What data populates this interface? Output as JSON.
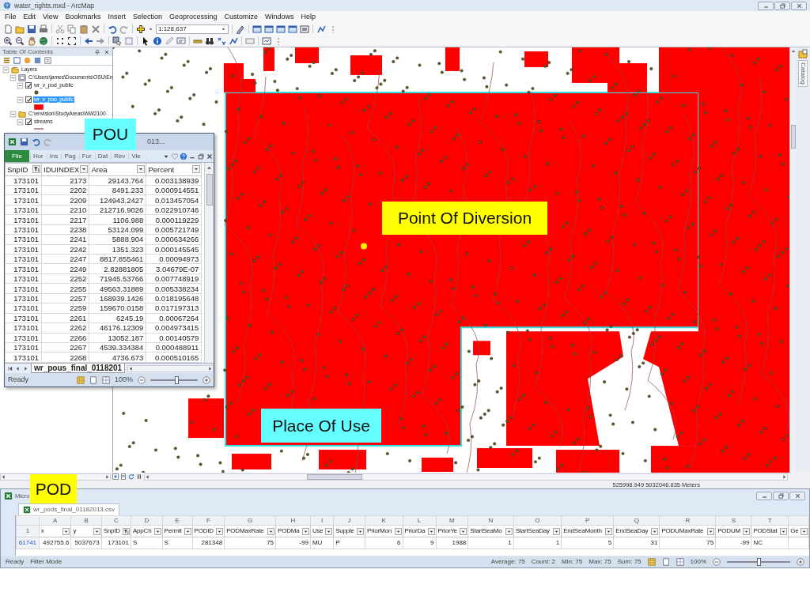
{
  "window": {
    "title": "water_rights.mxd - ArcMap"
  },
  "menu": [
    "File",
    "Edit",
    "View",
    "Bookmarks",
    "Insert",
    "Selection",
    "Geoprocessing",
    "Customize",
    "Windows",
    "Help"
  ],
  "toolbar": {
    "scale": "1:128,637"
  },
  "toc": {
    "title": "Table Of Contents",
    "tree": [
      {
        "label": "Layers",
        "kind": "frame",
        "expanded": true,
        "children": [
          {
            "label": "C:\\Users\\james\\Documents\\OSU\\En",
            "kind": "database",
            "expanded": true,
            "children": [
              {
                "label": "wr_v_pod_public",
                "kind": "point",
                "expanded": true,
                "checked": true,
                "selected": false
              },
              {
                "label": "wr_v_pou_public",
                "kind": "polygon",
                "expanded": true,
                "checked": true,
                "selected": true
              }
            ]
          },
          {
            "label": "C:\\envision\\StudyAreas\\WW2100",
            "kind": "folder",
            "expanded": true,
            "children": [
              {
                "label": "streams",
                "kind": "line",
                "expanded": true,
                "checked": true,
                "selected": false
              }
            ]
          }
        ]
      }
    ]
  },
  "catalog": "Catalog",
  "status_bar": {
    "coordinates": "525998.949  5032046.835 Meters"
  },
  "pou_sheet": {
    "title": "013...",
    "ribbon": [
      {
        "label": "File",
        "kind": "file"
      },
      {
        "label": "Hor",
        "kind": "tab"
      },
      {
        "label": "Ins",
        "kind": "tab"
      },
      {
        "label": "Pag",
        "kind": "tab"
      },
      {
        "label": "For",
        "kind": "tab"
      },
      {
        "label": "Dat",
        "kind": "tab"
      },
      {
        "label": "Rev",
        "kind": "tab"
      },
      {
        "label": "Vie",
        "kind": "tab"
      }
    ],
    "columns": [
      {
        "label": "SnpID",
        "filtered": true
      },
      {
        "label": "IDUINDEX",
        "filtered": false
      },
      {
        "label": "Area",
        "filtered": false
      },
      {
        "label": "Percent",
        "filtered": false
      }
    ],
    "rows": [
      [
        "173101",
        "2173",
        "29143.764",
        "0.003138939"
      ],
      [
        "173101",
        "2202",
        "8491.233",
        "0.000914551"
      ],
      [
        "173101",
        "2209",
        "124943.2427",
        "0.013457054"
      ],
      [
        "173101",
        "2210",
        "212716.9026",
        "0.022910746"
      ],
      [
        "173101",
        "2217",
        "1106.988",
        "0.000119229"
      ],
      [
        "173101",
        "2238",
        "53124.099",
        "0.005721749"
      ],
      [
        "173101",
        "2241",
        "5888.904",
        "0.000634266"
      ],
      [
        "173101",
        "2242",
        "1351.323",
        "0.000145545"
      ],
      [
        "173101",
        "2247",
        "8817.855461",
        "0.00094973"
      ],
      [
        "173101",
        "2249",
        "2.82881805",
        "3.04679E-07"
      ],
      [
        "173101",
        "2252",
        "71945.53766",
        "0.007748919"
      ],
      [
        "173101",
        "2255",
        "49563.31889",
        "0.005338234"
      ],
      [
        "173101",
        "2257",
        "168939.1426",
        "0.018195648"
      ],
      [
        "173101",
        "2259",
        "159670.0158",
        "0.017197313"
      ],
      [
        "173101",
        "2261",
        "6245.19",
        "0.00067264"
      ],
      [
        "173101",
        "2262",
        "46176.12309",
        "0.004973415"
      ],
      [
        "173101",
        "2266",
        "13052.187",
        "0.00140579"
      ],
      [
        "173101",
        "2267",
        "4539.334384",
        "0.000488911"
      ],
      [
        "173101",
        "2268",
        "4736.673",
        "0.000510165"
      ]
    ],
    "sheet_tab": "wr_pous_final_0118201",
    "status": "Ready",
    "zoom": "100%",
    "zoom_slider": {
      "level": 0.55
    }
  },
  "pod_sheet": {
    "title": "Micro",
    "file": "wr_pods_final_01182013.csv",
    "letters": [
      "A",
      "B",
      "C",
      "D",
      "E",
      "F",
      "G",
      "H",
      "I",
      "J",
      "K",
      "L",
      "M",
      "N",
      "O",
      "P",
      "Q",
      "R",
      "S",
      "T"
    ],
    "header_row": "1",
    "columns": [
      {
        "label": "x",
        "filtered": false
      },
      {
        "label": "y",
        "filtered": false
      },
      {
        "label": "SnpID",
        "filtered": true
      },
      {
        "label": "AppCh",
        "filtered": false
      },
      {
        "label": "Permit",
        "filtered": false
      },
      {
        "label": "PODID",
        "filtered": false
      },
      {
        "label": "PODMaxRate",
        "filtered": false
      },
      {
        "label": "PODMa",
        "filtered": false
      },
      {
        "label": "Use",
        "filtered": false
      },
      {
        "label": "Supple",
        "filtered": false
      },
      {
        "label": "PriorMon",
        "filtered": false
      },
      {
        "label": "PriorDa",
        "filtered": false
      },
      {
        "label": "PriorYe",
        "filtered": false
      },
      {
        "label": "StartSeaMo",
        "filtered": false
      },
      {
        "label": "StartSeaDay",
        "filtered": false
      },
      {
        "label": "EndSeaMonth",
        "filtered": false
      },
      {
        "label": "EndSeaDay",
        "filtered": false
      },
      {
        "label": "PODUMaxRate",
        "filtered": false
      },
      {
        "label": "PODUM",
        "filtered": false
      },
      {
        "label": "PODStat",
        "filtered": false
      },
      {
        "label": "Ge",
        "filtered": false
      }
    ],
    "rows": [
      {
        "number": "61741",
        "cells": [
          "492755.6",
          "5037673",
          "173101",
          "S",
          "S",
          "281348",
          "75",
          "-99",
          "MU",
          "P",
          "6",
          "9",
          "1988",
          "1",
          "1",
          "5",
          "31",
          "75",
          "-99",
          "NC"
        ]
      }
    ],
    "status": [
      "Ready",
      "Filter Mode"
    ],
    "stats": [
      "Average: 75",
      "Count: 2",
      "Min: 75",
      "Max: 75",
      "Sum: 75"
    ],
    "zoom": "100%",
    "zoom_slider": {
      "level": 0.5
    }
  },
  "callouts": [
    {
      "text": "POU",
      "color": "#66ffff"
    },
    {
      "text": "Point Of Diversion",
      "color": "#ffff00"
    },
    {
      "text": "Place Of Use",
      "color": "#66ffff"
    },
    {
      "text": "POD",
      "color": "#ffff00"
    }
  ]
}
